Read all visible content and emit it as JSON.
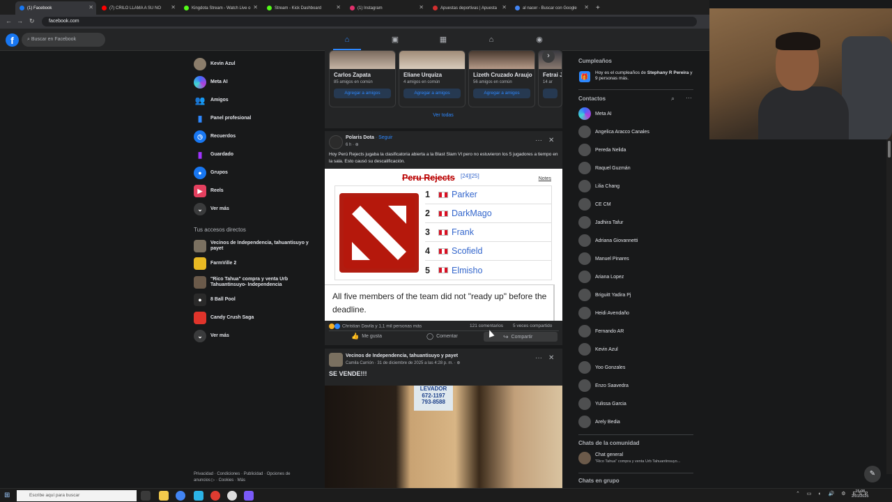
{
  "browser": {
    "tabs": [
      {
        "title": "(1) Facebook",
        "active": true,
        "color": "#1877f2"
      },
      {
        "title": "(7) CRILO LLAMA A SU NO",
        "active": false,
        "color": "#ff0000"
      },
      {
        "title": "Kingdota Stream - Watch Live o",
        "active": false,
        "color": "#53fc18"
      },
      {
        "title": "Stream - Kick Dashboard",
        "active": false,
        "color": "#53fc18"
      },
      {
        "title": "(1) Instagram",
        "active": false,
        "color": "#e1306c"
      },
      {
        "title": "Apuestas deportivas | Apuesta",
        "active": false,
        "color": "#d32f2f"
      },
      {
        "title": "al nacer - Buscar con Google",
        "active": false,
        "color": "#4285f4"
      }
    ],
    "new_tab": "+",
    "url": "facebook.com"
  },
  "fb_header": {
    "logo": "f",
    "search_placeholder": "Buscar en Facebook"
  },
  "left_sidebar": {
    "items": [
      {
        "label": "Kevin Azul",
        "icon": "profile-avatar",
        "color": "#8b7d6b"
      },
      {
        "label": "Meta AI",
        "icon": "meta-ai-icon",
        "color": "#6b3fd9"
      },
      {
        "label": "Amigos",
        "icon": "friends-icon",
        "color": "#1877f2"
      },
      {
        "label": "Panel profesional",
        "icon": "dashboard-icon",
        "color": "#1877f2"
      },
      {
        "label": "Recuerdos",
        "icon": "memories-icon",
        "color": "#1877f2"
      },
      {
        "label": "Guardado",
        "icon": "bookmark-icon",
        "color": "#a033ff"
      },
      {
        "label": "Grupos",
        "icon": "groups-icon",
        "color": "#1877f2"
      },
      {
        "label": "Reels",
        "icon": "reels-icon",
        "color": "#e4405f"
      },
      {
        "label": "Ver más",
        "icon": "chevron-down-icon",
        "color": "#3a3b3c"
      }
    ],
    "shortcuts_title": "Tus accesos directos",
    "shortcuts": [
      {
        "label": "Vecinos de Independencia, tahuantisuyo y payet",
        "color": "#7a7060"
      },
      {
        "label": "FarmVille 2",
        "color": "#e8b923"
      },
      {
        "label": "\"Rico Tahua\" compra y venta Urb Tahuantinsuyo- Independencia",
        "color": "#6b5a4a"
      },
      {
        "label": "8 Ball Pool",
        "color": "#2a2a2a"
      },
      {
        "label": "Candy Crush Saga",
        "color": "#e0342b"
      },
      {
        "label": "Ver más",
        "color": "#3a3b3c"
      }
    ],
    "footer": "Privacidad · Condiciones · Publicidad · Opciones de anuncios ▷ · Cookies · Más"
  },
  "friend_suggestions": {
    "cards": [
      {
        "name": "Carlos Zapata",
        "mutual": "85 amigos en común",
        "button": "Agregar a amigos"
      },
      {
        "name": "Eliane Urquiza",
        "mutual": "4 amigos en común",
        "button": "Agregar a amigos"
      },
      {
        "name": "Lizeth Cruzado Araujo",
        "mutual": "56 amigos en común",
        "button": "Agregar a amigos"
      },
      {
        "name": "Fetrai J",
        "mutual": "14 ar",
        "button": ""
      }
    ],
    "see_all": "Ver todas",
    "next": "›"
  },
  "post1": {
    "author": "Polaris Dota",
    "follow": "· Seguir",
    "meta": "6 h · ⊕",
    "text": "Hoy Perú Rejects jugaba la clasificatoria abierta a la Blast Slam VI pero no estuvieron los 5 jugadores a tiempo en la sala. Esto causó su descalificación.",
    "more": "···",
    "close": "✕",
    "image": {
      "team": "Peru Rejects",
      "refs": "[24][25]",
      "notes": "Notes",
      "players": [
        {
          "num": "1",
          "name": "Parker"
        },
        {
          "num": "2",
          "name": "DarkMago"
        },
        {
          "num": "3",
          "name": "Frank"
        },
        {
          "num": "4",
          "name": "Scofield"
        },
        {
          "num": "5",
          "name": "Elmisho"
        }
      ],
      "caption": "All five members of the team did not \"ready up\" before the deadline."
    },
    "reactions": "Christian Davila y 1,1 mil personas más",
    "comments": "121 comentarios",
    "shares": "5 veces compartido",
    "actions": {
      "like": "Me gusta",
      "comment": "Comentar",
      "share": "Compartir"
    }
  },
  "post2": {
    "group": "Vecinos de Independencia, tahuantisuyo y payet",
    "meta": "Camila Carrión · 31 de diciembre de 2025 a las 4:28 p. m. · ⊕",
    "text": "SE VENDE!!!",
    "more": "···",
    "close": "✕",
    "sign_text": "LEVADOR\n672-1197\n793-8588"
  },
  "right_sidebar": {
    "birthdays_title": "Cumpleaños",
    "birthday_text_pre": "Hoy es el cumpleaños de ",
    "birthday_name": "Stephany R Pereira",
    "birthday_text_post": " y 9 personas más.",
    "contacts_title": "Contactos",
    "contacts": [
      "Meta AI",
      "Angelica Aracco Canales",
      "Pereda Nelida",
      "Raquel Guzmán",
      "Lilia Chang",
      "CE CM",
      "Jadhira Tafur",
      "Adriana Giovannetti",
      "Manuel Pinares",
      "Ariana Lopez",
      "Briguitt Yadira Pj",
      "Heidi Avendaño",
      "Fernando AR",
      "Kevin Azul",
      "Yoo Gonzales",
      "Enzo Saavedra",
      "Yulissa Garcia",
      "Arely Bedia"
    ],
    "community_title": "Chats de la comunidad",
    "community_chat": "Chat general",
    "community_sub": "\"Rico Tahua\" compra y venta Urb Tahuantinsuyo...",
    "group_chats_title": "Chats en grupo"
  },
  "taskbar": {
    "search_placeholder": "Escribe aquí para buscar",
    "time": "15:08",
    "date": "2/01/2025",
    "lang": "ESP"
  }
}
